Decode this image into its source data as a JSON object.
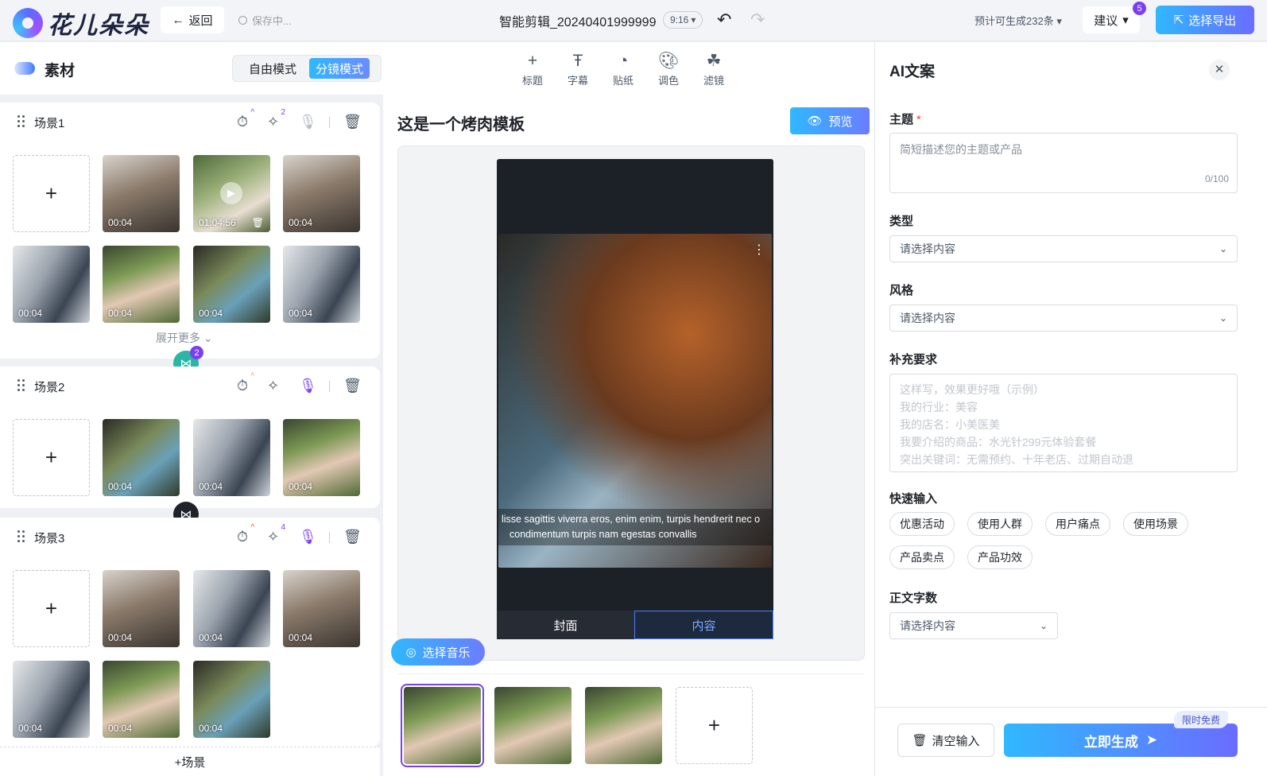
{
  "app": {
    "logo_text": "花儿朵朵",
    "back_label": "返回",
    "save_status": "保存中...",
    "doc_title": "智能剪辑_20240401999999",
    "ratio": "9:16",
    "estimate": "预计可生成232条",
    "suggest_label": "建议",
    "suggest_badge": "5",
    "export_label": "选择导出"
  },
  "left": {
    "title": "素材",
    "mode_free": "自由模式",
    "mode_shot": "分镜模式",
    "expand_more": "展开更多",
    "add_scene": "+场景",
    "scenes": [
      {
        "name": "场景1",
        "speed_badge": "^",
        "effect_badge": "2",
        "clips": [
          "00:04",
          "01:04:56",
          "00:04",
          "00:04",
          "00:04",
          "00:04",
          "00:04"
        ]
      },
      {
        "name": "场景2",
        "speed_badge": "^",
        "effect_badge": "",
        "clips": [
          "00:04",
          "00:04",
          "00:04"
        ]
      },
      {
        "name": "场景3",
        "speed_badge": "^",
        "effect_badge": "4",
        "clips": [
          "00:04",
          "00:04",
          "00:04",
          "00:04",
          "00:04",
          "00:04"
        ]
      }
    ],
    "transition_count": "2"
  },
  "center": {
    "tools": [
      {
        "label": "标题",
        "icon": "plus-icon"
      },
      {
        "label": "字幕",
        "icon": "text-icon"
      },
      {
        "label": "贴纸",
        "icon": "sticker-icon"
      },
      {
        "label": "调色",
        "icon": "palette-icon"
      },
      {
        "label": "滤镜",
        "icon": "filter-icon"
      }
    ],
    "template_title": "这是一个烤肉模板",
    "preview_label": "预览",
    "subtitle_line1": "lisse sagittis viverra eros, enim enim, turpis hendrerit nec o",
    "subtitle_line2": "condimentum turpis nam egestas convallis",
    "tab_cover": "封面",
    "tab_content": "内容",
    "music_label": "选择音乐"
  },
  "right": {
    "title": "AI文案",
    "topic_label": "主题",
    "topic_placeholder": "简短描述您的主题或产品",
    "topic_count": "0/100",
    "type_label": "类型",
    "type_value": "请选择内容",
    "style_label": "风格",
    "style_value": "请选择内容",
    "extra_label": "补充要求",
    "extra_placeholder": [
      "这样写，效果更好哦（示例）",
      "我的行业：美容",
      "我的店名：小美医美",
      "我要介绍的商品：水光针299元体验套餐",
      "突出关键词：无需预约、十年老店、过期自动退"
    ],
    "quick_label": "快速输入",
    "quick_chips": [
      "优惠活动",
      "使用人群",
      "用户痛点",
      "使用场景",
      "产品卖点",
      "产品功效"
    ],
    "wordcount_label": "正文字数",
    "wordcount_value": "请选择内容",
    "clear_label": "清空输入",
    "generate_label": "立即生成",
    "free_tag": "限时免费"
  }
}
